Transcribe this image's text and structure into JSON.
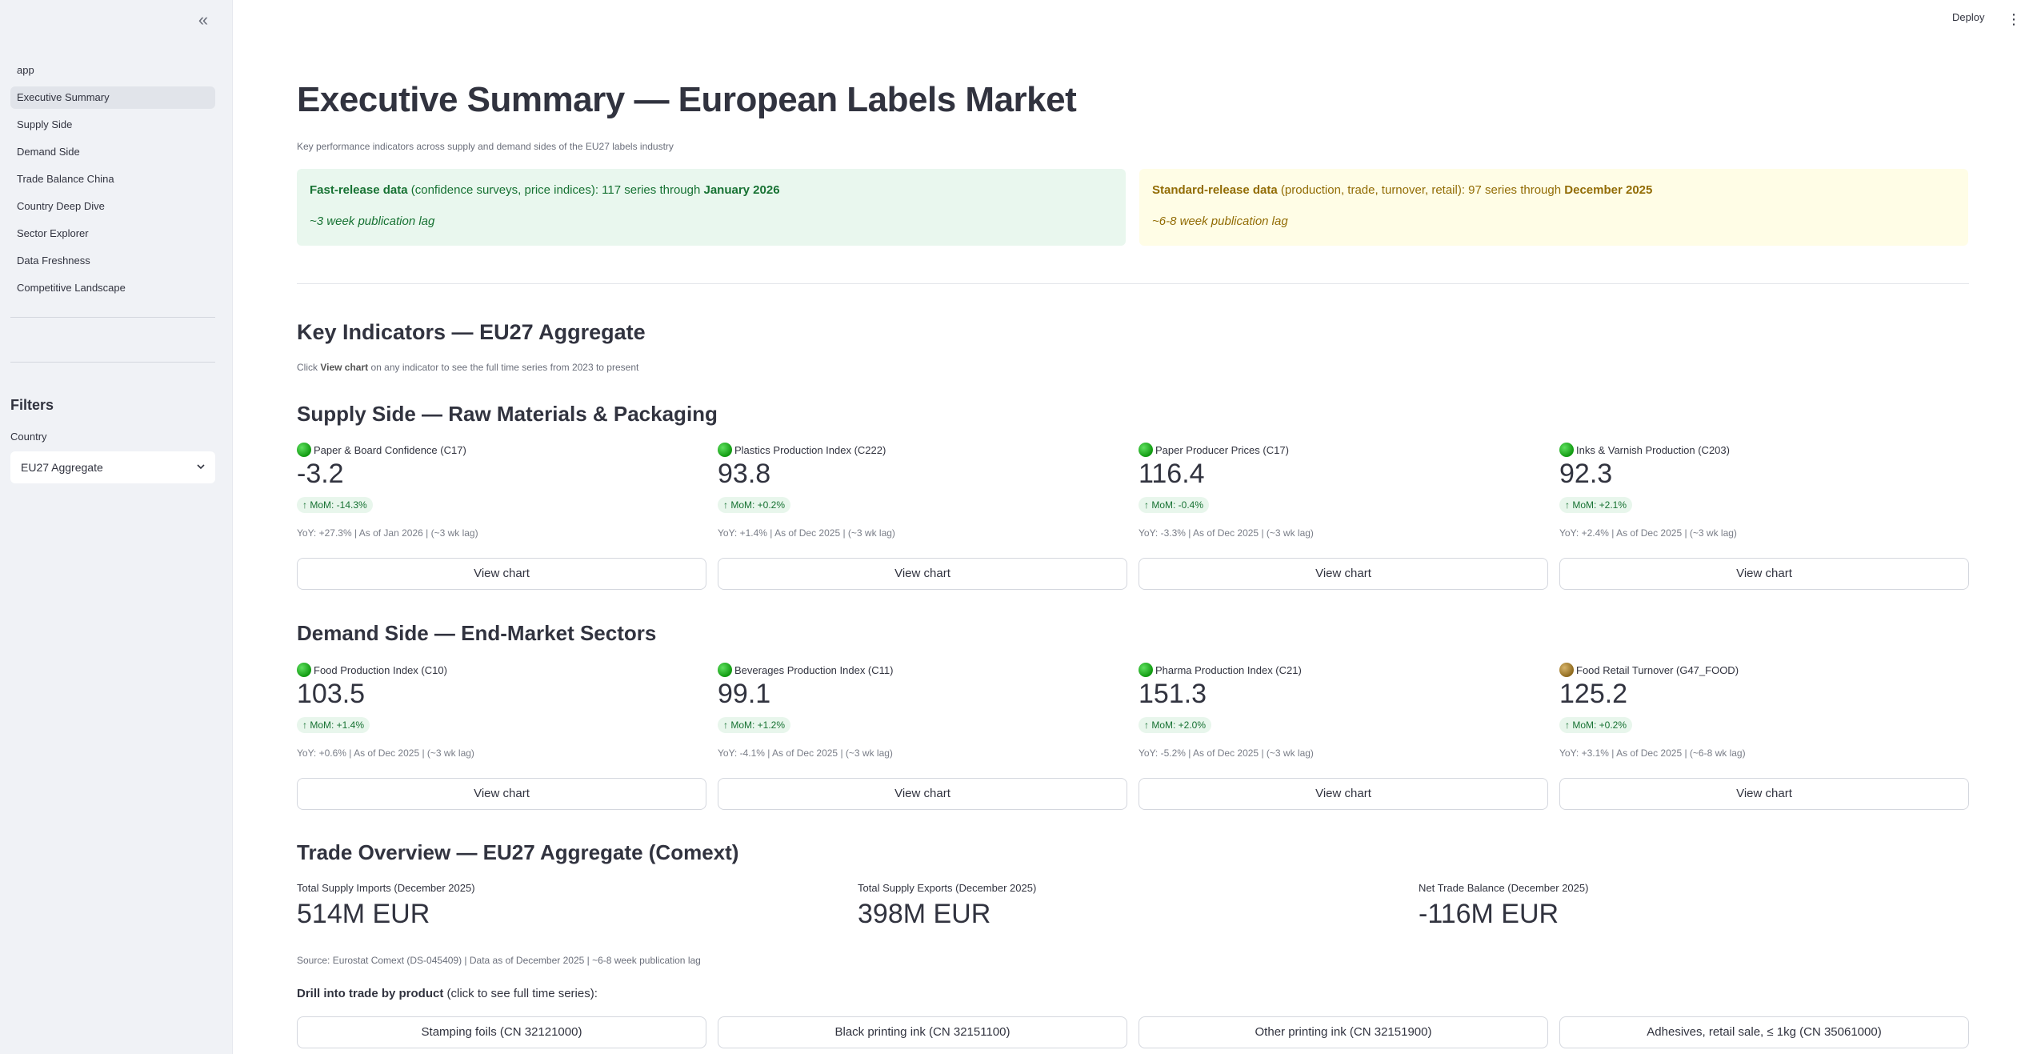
{
  "sidebar": {
    "collapse_icon": "«",
    "items": [
      {
        "label": "app"
      },
      {
        "label": "Executive Summary"
      },
      {
        "label": "Supply Side"
      },
      {
        "label": "Demand Side"
      },
      {
        "label": "Trade Balance China"
      },
      {
        "label": "Country Deep Dive"
      },
      {
        "label": "Sector Explorer"
      },
      {
        "label": "Data Freshness"
      },
      {
        "label": "Competitive Landscape"
      }
    ],
    "active_item": "Executive Summary",
    "filters_title": "Filters",
    "country_label": "Country",
    "country_value": "EU27 Aggregate"
  },
  "topbar": {
    "deploy_label": "Deploy"
  },
  "header": {
    "title": "Executive Summary — European Labels Market",
    "subtitle": "Key performance indicators across supply and demand sides of the EU27 labels industry"
  },
  "banners": {
    "fast": {
      "bold": "Fast-release data",
      "text": " (confidence surveys, price indices): 117 series through ",
      "date": "January 2026",
      "lag": "~3 week publication lag"
    },
    "standard": {
      "bold": "Standard-release data",
      "text": " (production, trade, turnover, retail): 97 series through ",
      "date": "December 2025",
      "lag": "~6-8 week publication lag"
    }
  },
  "key_indicators": {
    "title": "Key Indicators — EU27 Aggregate",
    "caption_pre": "Click ",
    "caption_bold": "View chart",
    "caption_post": " on any indicator to see the full time series from 2023 to present"
  },
  "supply": {
    "title": "Supply Side — Raw Materials & Packaging",
    "cards": [
      {
        "label": "Paper & Board Confidence (C17)",
        "value": "-3.2",
        "delta": "↑ MoM: -14.3%",
        "meta": "YoY: +27.3% | As of Jan 2026 | (~3 wk lag)",
        "button": "View chart",
        "status": "green"
      },
      {
        "label": "Plastics Production Index (C222)",
        "value": "93.8",
        "delta": "↑ MoM: +0.2%",
        "meta": "YoY: +1.4% | As of Dec 2025 | (~3 wk lag)",
        "button": "View chart",
        "status": "green"
      },
      {
        "label": "Paper Producer Prices (C17)",
        "value": "116.4",
        "delta": "↑ MoM: -0.4%",
        "meta": "YoY: -3.3% | As of Dec 2025 | (~3 wk lag)",
        "button": "View chart",
        "status": "green"
      },
      {
        "label": "Inks & Varnish Production (C203)",
        "value": "92.3",
        "delta": "↑ MoM: +2.1%",
        "meta": "YoY: +2.4% | As of Dec 2025 | (~3 wk lag)",
        "button": "View chart",
        "status": "green"
      }
    ]
  },
  "demand": {
    "title": "Demand Side — End-Market Sectors",
    "cards": [
      {
        "label": "Food Production Index (C10)",
        "value": "103.5",
        "delta": "↑ MoM: +1.4%",
        "meta": "YoY: +0.6% | As of Dec 2025 | (~3 wk lag)",
        "button": "View chart",
        "status": "green"
      },
      {
        "label": "Beverages Production Index (C11)",
        "value": "99.1",
        "delta": "↑ MoM: +1.2%",
        "meta": "YoY: -4.1% | As of Dec 2025 | (~3 wk lag)",
        "button": "View chart",
        "status": "green"
      },
      {
        "label": "Pharma Production Index (C21)",
        "value": "151.3",
        "delta": "↑ MoM: +2.0%",
        "meta": "YoY: -5.2% | As of Dec 2025 | (~3 wk lag)",
        "button": "View chart",
        "status": "green"
      },
      {
        "label": "Food Retail Turnover (G47_FOOD)",
        "value": "125.2",
        "delta": "↑ MoM: +0.2%",
        "meta": "YoY: +3.1% | As of Dec 2025 | (~6-8 wk lag)",
        "button": "View chart",
        "status": "amber"
      }
    ]
  },
  "trade": {
    "title": "Trade Overview — EU27 Aggregate (Comext)",
    "metrics": [
      {
        "label": "Total Supply Imports (December 2025)",
        "value": "514M EUR"
      },
      {
        "label": "Total Supply Exports (December 2025)",
        "value": "398M EUR"
      },
      {
        "label": "Net Trade Balance (December 2025)",
        "value": "-116M EUR"
      }
    ],
    "source": "Source: Eurostat Comext (DS-045409) | Data as of December 2025 | ~6-8 week publication lag",
    "drill_bold": "Drill into trade by product",
    "drill_post": " (click to see full time series):",
    "products": [
      {
        "label": "Stamping foils (CN 32121000)"
      },
      {
        "label": "Black printing ink (CN 32151100)"
      },
      {
        "label": "Other printing ink (CN 32151900)"
      },
      {
        "label": "Adhesives, retail sale, ≤ 1kg (CN 35061000)"
      }
    ]
  },
  "colors": {
    "status_green": "#119a11",
    "status_amber": "#8f6a1e",
    "delta_green": "#177233"
  }
}
